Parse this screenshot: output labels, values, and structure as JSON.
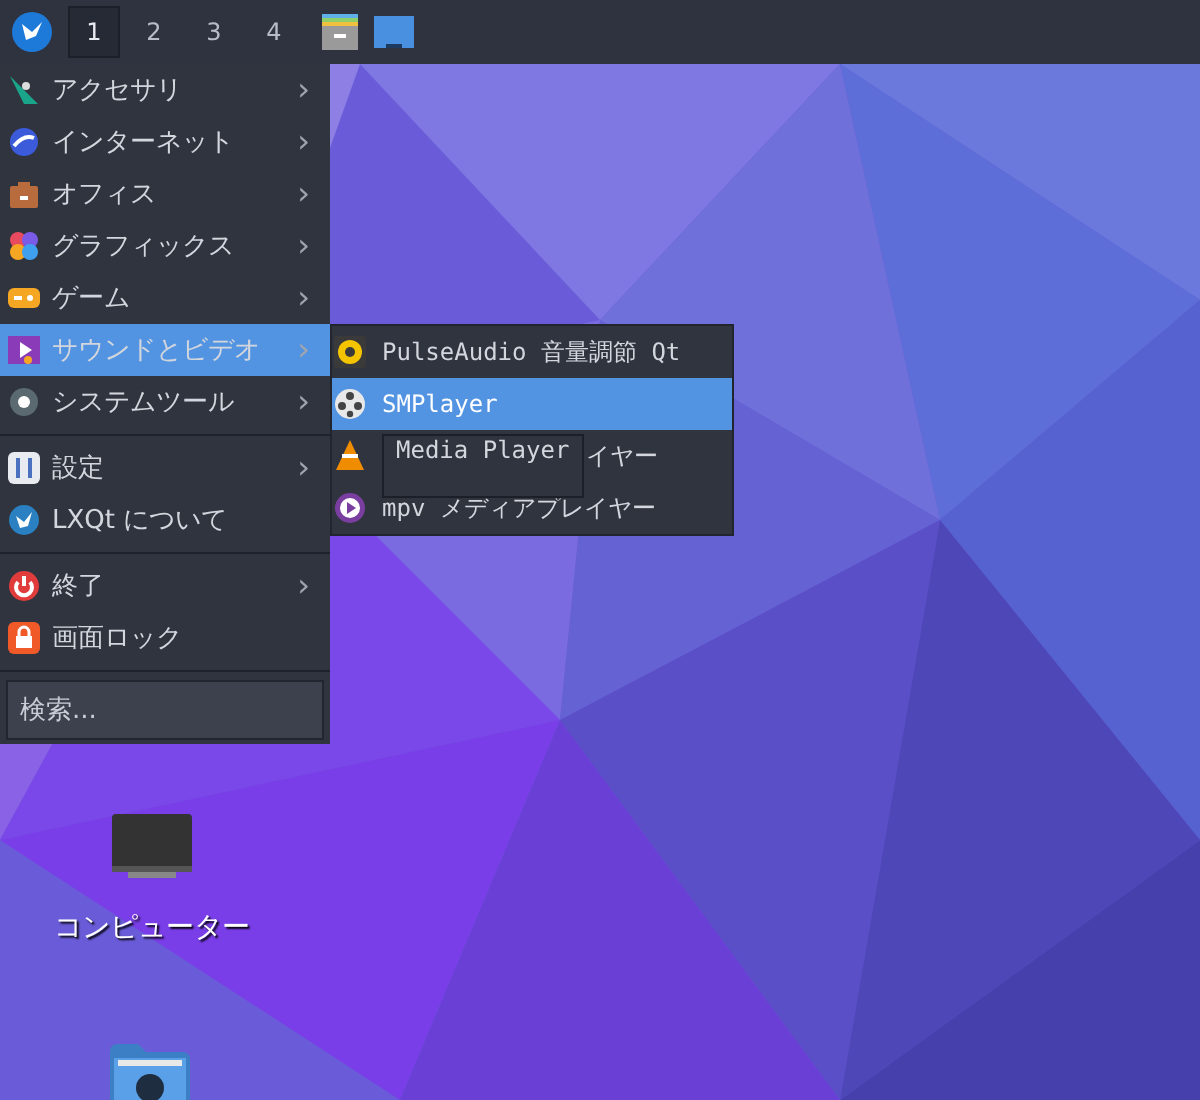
{
  "taskbar": {
    "workspaces": [
      {
        "label": "1",
        "selected": true
      },
      {
        "label": "2",
        "selected": false
      },
      {
        "label": "3",
        "selected": false
      },
      {
        "label": "4",
        "selected": false
      }
    ]
  },
  "menu": {
    "items": [
      {
        "kind": "item",
        "label": "アクセサリ",
        "submenu": true,
        "selected": false
      },
      {
        "kind": "item",
        "label": "インターネット",
        "submenu": true,
        "selected": false
      },
      {
        "kind": "item",
        "label": "オフィス",
        "submenu": true,
        "selected": false
      },
      {
        "kind": "item",
        "label": "グラフィックス",
        "submenu": true,
        "selected": false
      },
      {
        "kind": "item",
        "label": "ゲーム",
        "submenu": true,
        "selected": false
      },
      {
        "kind": "item",
        "label": "サウンドとビデオ",
        "submenu": true,
        "selected": true
      },
      {
        "kind": "item",
        "label": "システムツール",
        "submenu": true,
        "selected": false
      },
      {
        "kind": "separator"
      },
      {
        "kind": "item",
        "label": "設定",
        "submenu": true,
        "selected": false
      },
      {
        "kind": "item",
        "label": "LXQt について",
        "submenu": false,
        "selected": false
      },
      {
        "kind": "separator"
      },
      {
        "kind": "item",
        "label": "終了",
        "submenu": true,
        "selected": false
      },
      {
        "kind": "item",
        "label": "画面ロック",
        "submenu": false,
        "selected": false
      },
      {
        "kind": "separator"
      }
    ],
    "arrow": "›",
    "search": {
      "placeholder": "検索..."
    }
  },
  "submenu": {
    "items": [
      {
        "kind": "item",
        "label": "PulseAudio 音量調節 Qt",
        "selected": false
      },
      {
        "kind": "item",
        "label": "SMPlayer",
        "selected": true
      },
      {
        "kind": "covered",
        "label": "イヤー",
        "selected": false
      },
      {
        "kind": "item",
        "label": "mpv メディアプレイヤー",
        "selected": false
      }
    ]
  },
  "tooltip": {
    "text": "Media Player"
  },
  "desktop": {
    "icons": [
      {
        "label": "コンピューター"
      }
    ]
  }
}
